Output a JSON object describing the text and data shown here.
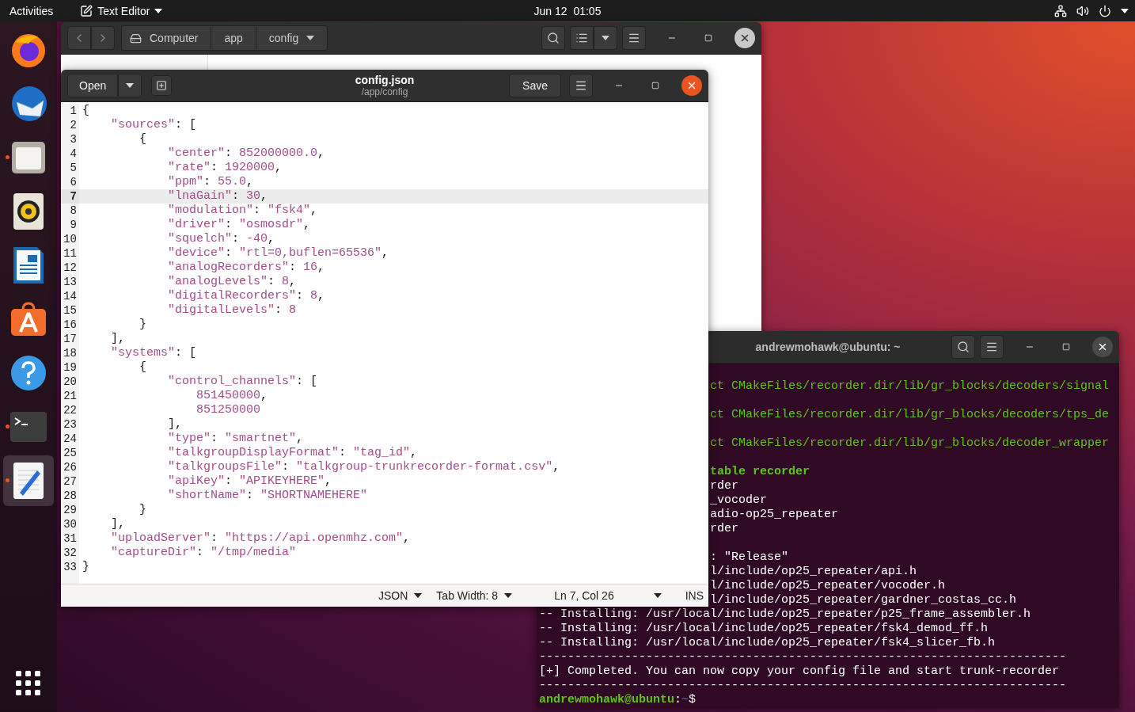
{
  "top_bar": {
    "activities": "Activities",
    "app_menu": "Text Editor",
    "clock": "Jun 12  01:05"
  },
  "dock": {
    "items": [
      {
        "kind": "browser",
        "running": false,
        "selected": false
      },
      {
        "kind": "mail",
        "running": false,
        "selected": false
      },
      {
        "kind": "files",
        "running": true,
        "selected": false
      },
      {
        "kind": "music",
        "running": false,
        "selected": false
      },
      {
        "kind": "writer",
        "running": false,
        "selected": false
      },
      {
        "kind": "store",
        "running": false,
        "selected": false
      },
      {
        "kind": "help",
        "running": false,
        "selected": false
      },
      {
        "kind": "terminal",
        "running": true,
        "selected": false
      },
      {
        "kind": "editor",
        "running": true,
        "selected": true
      }
    ]
  },
  "file_manager": {
    "path": [
      {
        "label": "Computer",
        "kind": "root"
      },
      {
        "label": "app",
        "kind": "folder"
      },
      {
        "label": "config",
        "kind": "current"
      }
    ]
  },
  "terminal": {
    "title": "andrewmohawk@ubuntu: ~",
    "lines": [
      {
        "kind": "build",
        "text": "ct CMakeFiles/recorder.dir/lib/gr_blocks/decoders/signal"
      },
      {
        "kind": "gap"
      },
      {
        "kind": "build",
        "text": "ct CMakeFiles/recorder.dir/lib/gr_blocks/decoders/tps_de"
      },
      {
        "kind": "gap"
      },
      {
        "kind": "build",
        "text": "ct CMakeFiles/recorder.dir/lib/gr_blocks/decoder_wrapper"
      },
      {
        "kind": "gap"
      },
      {
        "kind": "target",
        "text": "table recorder"
      },
      {
        "kind": "covered",
        "text": "rder"
      },
      {
        "kind": "covered",
        "text": "_vocoder"
      },
      {
        "kind": "covered",
        "text": "adio-op25_repeater"
      },
      {
        "kind": "covered",
        "text": "rder"
      },
      {
        "kind": "gap"
      },
      {
        "kind": "covered",
        "text": ": \"Release\""
      },
      {
        "kind": "covered",
        "text": "l/include/op25_repeater/api.h"
      },
      {
        "kind": "covered",
        "text": "l/include/op25_repeater/vocoder.h"
      },
      {
        "kind": "covered",
        "text": "l/include/op25_repeater/gardner_costas_cc.h"
      },
      {
        "kind": "full",
        "text": "-- Installing: /usr/local/include/op25_repeater/p25_frame_assembler.h"
      },
      {
        "kind": "full",
        "text": "-- Installing: /usr/local/include/op25_repeater/fsk4_demod_ff.h"
      },
      {
        "kind": "full",
        "text": "-- Installing: /usr/local/include/op25_repeater/fsk4_slicer_fb.h"
      },
      {
        "kind": "full",
        "text": "--------------------------------------------------------------------------"
      },
      {
        "kind": "full",
        "text": "[+] Completed. You can now copy your config file and start trunk-recorder"
      },
      {
        "kind": "full",
        "text": "--------------------------------------------------------------------------"
      },
      {
        "kind": "prompt",
        "user": "andrewmohawk@ubuntu",
        "separator": ":",
        "path": "~",
        "symbol": "$"
      }
    ]
  },
  "editor": {
    "open": "Open",
    "title": "config.json",
    "subtitle": "/app/config",
    "save": "Save",
    "lines": [
      {
        "number": "1",
        "text": "{",
        "current": false
      },
      {
        "number": "2",
        "text": "    \"sources\": [",
        "current": false
      },
      {
        "number": "3",
        "text": "        {",
        "current": false
      },
      {
        "number": "4",
        "text": "            \"center\": 852000000.0,",
        "current": false
      },
      {
        "number": "5",
        "text": "            \"rate\": 1920000,",
        "current": false
      },
      {
        "number": "6",
        "text": "            \"ppm\": 55.0,",
        "current": false
      },
      {
        "number": "7",
        "text": "            \"lnaGain\": 30,",
        "current": true
      },
      {
        "number": "8",
        "text": "            \"modulation\": \"fsk4\",",
        "current": false
      },
      {
        "number": "9",
        "text": "            \"driver\": \"osmosdr\",",
        "current": false
      },
      {
        "number": "10",
        "text": "            \"squelch\": -40,",
        "current": false
      },
      {
        "number": "11",
        "text": "            \"device\": \"rtl=0,buflen=65536\",",
        "current": false
      },
      {
        "number": "12",
        "text": "            \"analogRecorders\": 16,",
        "current": false
      },
      {
        "number": "13",
        "text": "            \"analogLevels\": 8,",
        "current": false
      },
      {
        "number": "14",
        "text": "            \"digitalRecorders\": 8,",
        "current": false
      },
      {
        "number": "15",
        "text": "            \"digitalLevels\": 8",
        "current": false
      },
      {
        "number": "16",
        "text": "        }",
        "current": false
      },
      {
        "number": "17",
        "text": "    ],",
        "current": false
      },
      {
        "number": "18",
        "text": "    \"systems\": [",
        "current": false
      },
      {
        "number": "19",
        "text": "        {",
        "current": false
      },
      {
        "number": "20",
        "text": "            \"control_channels\": [",
        "current": false
      },
      {
        "number": "21",
        "text": "                851450000,",
        "current": false
      },
      {
        "number": "22",
        "text": "                851250000",
        "current": false
      },
      {
        "number": "23",
        "text": "            ],",
        "current": false
      },
      {
        "number": "24",
        "text": "            \"type\": \"smartnet\",",
        "current": false
      },
      {
        "number": "25",
        "text": "            \"talkgroupDisplayFormat\": \"tag_id\",",
        "current": false
      },
      {
        "number": "26",
        "text": "            \"talkgroupsFile\": \"talkgroup-trunkrecorder-format.csv\",",
        "current": false
      },
      {
        "number": "27",
        "text": "            \"apiKey\": \"APIKEYHERE\",",
        "current": false
      },
      {
        "number": "28",
        "text": "            \"shortName\": \"SHORTNAMEHERE\"",
        "current": false
      },
      {
        "number": "29",
        "text": "        }",
        "current": false
      },
      {
        "number": "30",
        "text": "    ],",
        "current": false
      },
      {
        "number": "31",
        "text": "    \"uploadServer\": \"https://api.openmhz.com\",",
        "current": false
      },
      {
        "number": "32",
        "text": "    \"captureDir\": \"/tmp/media\"",
        "current": false
      },
      {
        "number": "33",
        "text": "}",
        "current": false
      }
    ],
    "status": {
      "language": "JSON",
      "tab_width": "Tab Width: 8",
      "position": "Ln 7, Col 26",
      "mode": "INS"
    }
  }
}
